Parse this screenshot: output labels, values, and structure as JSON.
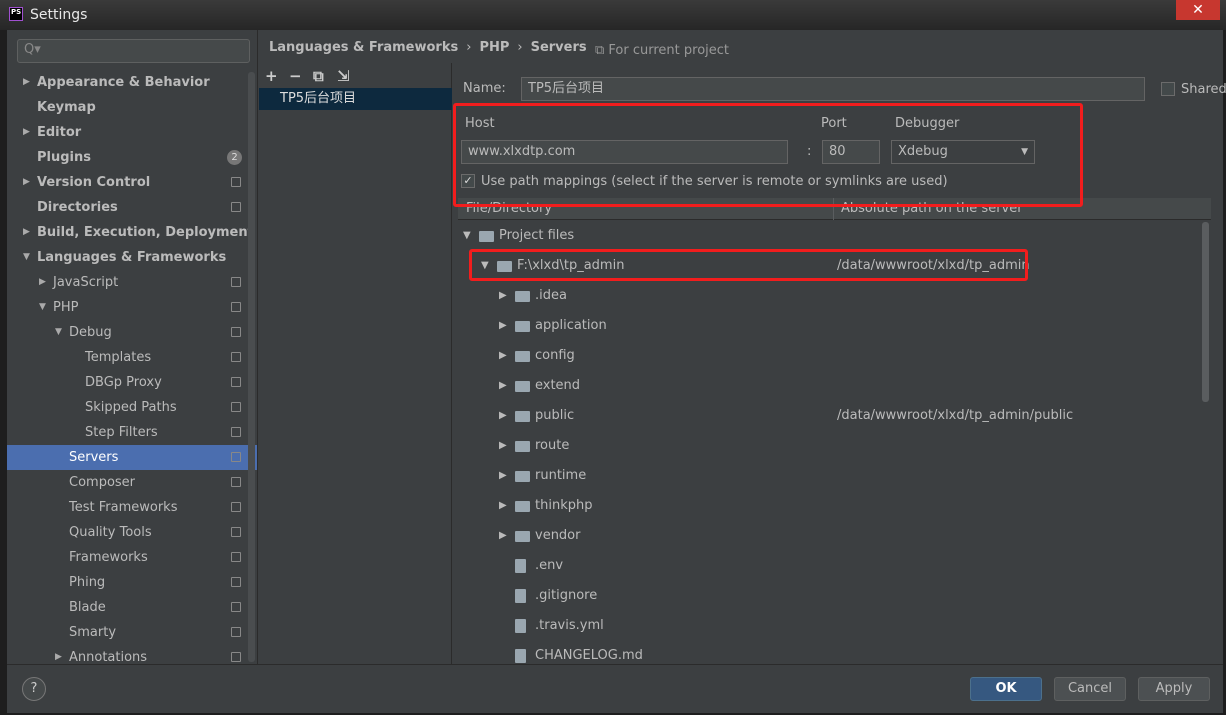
{
  "window": {
    "title": "Settings",
    "logo": "PS"
  },
  "search": {
    "placeholder": "Q▾"
  },
  "sidebar": {
    "items": [
      {
        "label": "Appearance & Behavior",
        "level": 0,
        "arrow": "right",
        "bold": true
      },
      {
        "label": "Keymap",
        "level": 0,
        "bold": true
      },
      {
        "label": "Editor",
        "level": 0,
        "arrow": "right",
        "bold": true
      },
      {
        "label": "Plugins",
        "level": 0,
        "bold": true,
        "badge": "2"
      },
      {
        "label": "Version Control",
        "level": 0,
        "arrow": "right",
        "bold": true,
        "project": true
      },
      {
        "label": "Directories",
        "level": 0,
        "bold": true,
        "project": true
      },
      {
        "label": "Build, Execution, Deployment",
        "level": 0,
        "arrow": "right",
        "bold": true
      },
      {
        "label": "Languages & Frameworks",
        "level": 0,
        "arrow": "down",
        "bold": true
      },
      {
        "label": "JavaScript",
        "level": 1,
        "arrow": "right",
        "project": true
      },
      {
        "label": "PHP",
        "level": 1,
        "arrow": "down",
        "project": true
      },
      {
        "label": "Debug",
        "level": 2,
        "arrow": "down",
        "project": true
      },
      {
        "label": "Templates",
        "level": 3,
        "project": true
      },
      {
        "label": "DBGp Proxy",
        "level": 3,
        "project": true
      },
      {
        "label": "Skipped Paths",
        "level": 3,
        "project": true
      },
      {
        "label": "Step Filters",
        "level": 3,
        "project": true
      },
      {
        "label": "Servers",
        "level": 2,
        "project": true,
        "selected": true
      },
      {
        "label": "Composer",
        "level": 2,
        "project": true
      },
      {
        "label": "Test Frameworks",
        "level": 2,
        "project": true
      },
      {
        "label": "Quality Tools",
        "level": 2,
        "project": true
      },
      {
        "label": "Frameworks",
        "level": 2,
        "project": true
      },
      {
        "label": "Phing",
        "level": 2,
        "project": true
      },
      {
        "label": "Blade",
        "level": 2,
        "project": true
      },
      {
        "label": "Smarty",
        "level": 2,
        "project": true
      },
      {
        "label": "Annotations",
        "level": 2,
        "arrow": "right",
        "project": true
      }
    ]
  },
  "breadcrumb": [
    "Languages & Frameworks",
    "PHP",
    "Servers"
  ],
  "for_current_project": "For current project",
  "servers": {
    "toolbar": [
      "+",
      "−",
      "⧉",
      "⇲"
    ],
    "items": [
      "TP5后台项目"
    ]
  },
  "form": {
    "name_label": "Name:",
    "name_value": "TP5后台项目",
    "shared_label": "Shared",
    "shared": false,
    "host_label": "Host",
    "host_value": "www.xlxdtp.com",
    "colon": ":",
    "port_label": "Port",
    "port_value": "80",
    "debugger_label": "Debugger",
    "debugger_value": "Xdebug",
    "path_mappings_label": "Use path mappings (select if the server is remote or symlinks are used)",
    "path_mappings": true
  },
  "mappings": {
    "columns": [
      "File/Directory",
      "Absolute path on the server"
    ],
    "rows": [
      {
        "name": "Project files",
        "level": 0,
        "type": "folder",
        "arrow": "down",
        "path": ""
      },
      {
        "name": "F:\\xlxd\\tp_admin",
        "level": 1,
        "type": "folder",
        "arrow": "down",
        "path": "/data/wwwroot/xlxd/tp_admin"
      },
      {
        "name": ".idea",
        "level": 2,
        "type": "folder",
        "arrow": "right",
        "path": ""
      },
      {
        "name": "application",
        "level": 2,
        "type": "folder",
        "arrow": "right",
        "path": ""
      },
      {
        "name": "config",
        "level": 2,
        "type": "folder",
        "arrow": "right",
        "path": ""
      },
      {
        "name": "extend",
        "level": 2,
        "type": "folder",
        "arrow": "right",
        "path": ""
      },
      {
        "name": "public",
        "level": 2,
        "type": "folder",
        "arrow": "right",
        "path": "/data/wwwroot/xlxd/tp_admin/public"
      },
      {
        "name": "route",
        "level": 2,
        "type": "folder",
        "arrow": "right",
        "path": ""
      },
      {
        "name": "runtime",
        "level": 2,
        "type": "folder",
        "arrow": "right",
        "path": ""
      },
      {
        "name": "thinkphp",
        "level": 2,
        "type": "folder",
        "arrow": "right",
        "path": ""
      },
      {
        "name": "vendor",
        "level": 2,
        "type": "folder",
        "arrow": "right",
        "path": ""
      },
      {
        "name": ".env",
        "level": 2,
        "type": "file",
        "path": ""
      },
      {
        "name": ".gitignore",
        "level": 2,
        "type": "file",
        "path": ""
      },
      {
        "name": ".travis.yml",
        "level": 2,
        "type": "file",
        "path": ""
      },
      {
        "name": "CHANGELOG.md",
        "level": 2,
        "type": "file",
        "path": ""
      }
    ]
  },
  "footer": {
    "help": "?",
    "ok": "OK",
    "cancel": "Cancel",
    "apply": "Apply"
  },
  "colors": {
    "selection": "#4b6eaf",
    "highlight": "#f21d1d",
    "ok": "#365880"
  }
}
